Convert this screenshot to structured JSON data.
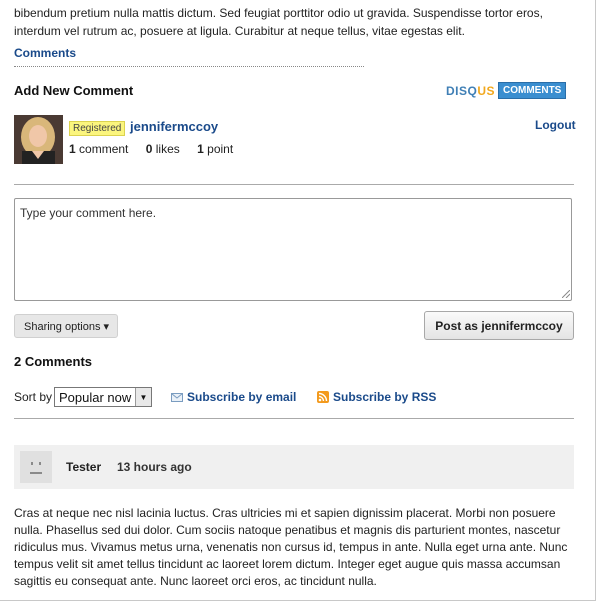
{
  "intro": {
    "text": "bibendum pretium nulla mattis dictum. Sed feugiat porttitor odio ut gravida. Suspendisse tortor eros, interdum vel rutrum ac, posuere at ligula. Curabitur at neque tellus, vitae egestas elit."
  },
  "comments_link": "Comments",
  "add_comment": {
    "title": "Add New Comment",
    "brand_d1": "DISQ",
    "brand_d2": "US",
    "brand_tag": "COMMENTS"
  },
  "user": {
    "badge": "Registered",
    "username": "jennifermccoy",
    "logout_label": "Logout",
    "comments_count": "1",
    "comments_label": "comment",
    "likes_count": "0",
    "likes_label": "likes",
    "points_count": "1",
    "points_label": "point"
  },
  "composer": {
    "placeholder": "Type your comment here.",
    "sharing_label": "Sharing options ▾",
    "post_label": "Post as jennifermccoy"
  },
  "thread": {
    "count_title": "2 Comments",
    "sort_label": "Sort by",
    "sort_value": "Popular now",
    "subscribe_email": "Subscribe by email",
    "subscribe_rss": "Subscribe by RSS"
  },
  "comments": [
    {
      "author": "Tester",
      "time": "13 hours ago",
      "body": "Cras at neque nec nisl lacinia luctus. Cras ultricies mi et sapien dignissim placerat. Morbi non posuere nulla. Phasellus sed dui dolor. Cum sociis natoque penatibus et magnis dis parturient montes, nascetur ridiculus mus. Vivamus metus urna, venenatis non cursus id, tempus in ante. Nulla eget urna ante. Nunc tempus velit sit amet tellus tincidunt ac laoreet lorem dictum. Integer eget augue quis massa accumsan sagittis eu consequat ante. Nunc laoreet orci eros, ac tincidunt nulla."
    }
  ],
  "colors": {
    "link": "#1a4a8a",
    "badge_bg": "#fbf57e",
    "disqus_blue": "#3a8ed0",
    "disqus_orange": "#f2a81d"
  },
  "icons": {
    "email": "envelope-icon",
    "rss": "rss-icon",
    "avatar_placeholder": "default-avatar-icon"
  }
}
